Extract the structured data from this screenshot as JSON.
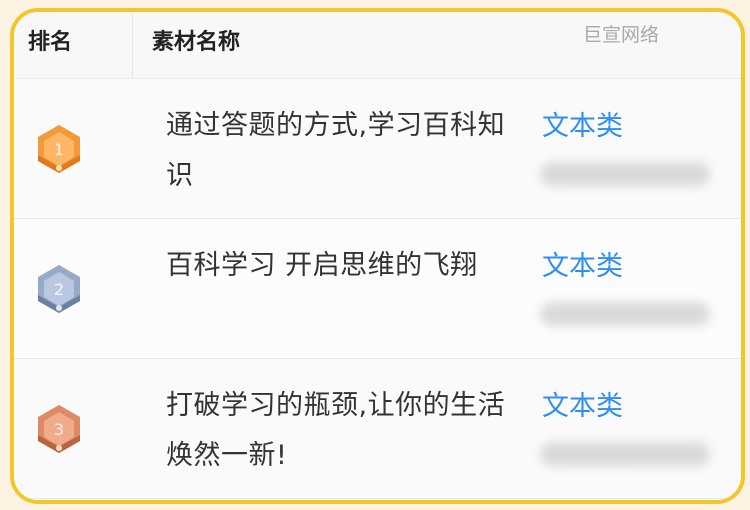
{
  "watermark": "巨宣网络",
  "header": {
    "rank_label": "排名",
    "name_label": "素材名称"
  },
  "rows": [
    {
      "rank": "1",
      "title": "通过答题的方式,学习百科知识",
      "category": "文本类",
      "medal_color": "#f08a2c"
    },
    {
      "rank": "2",
      "title": "百科学习 开启思维的飞翔",
      "category": "文本类",
      "medal_color": "#8fa3c4"
    },
    {
      "rank": "3",
      "title": "打破学习的瓶颈,让你的生活焕然一新!",
      "category": "文本类",
      "medal_color": "#d9835f"
    }
  ]
}
